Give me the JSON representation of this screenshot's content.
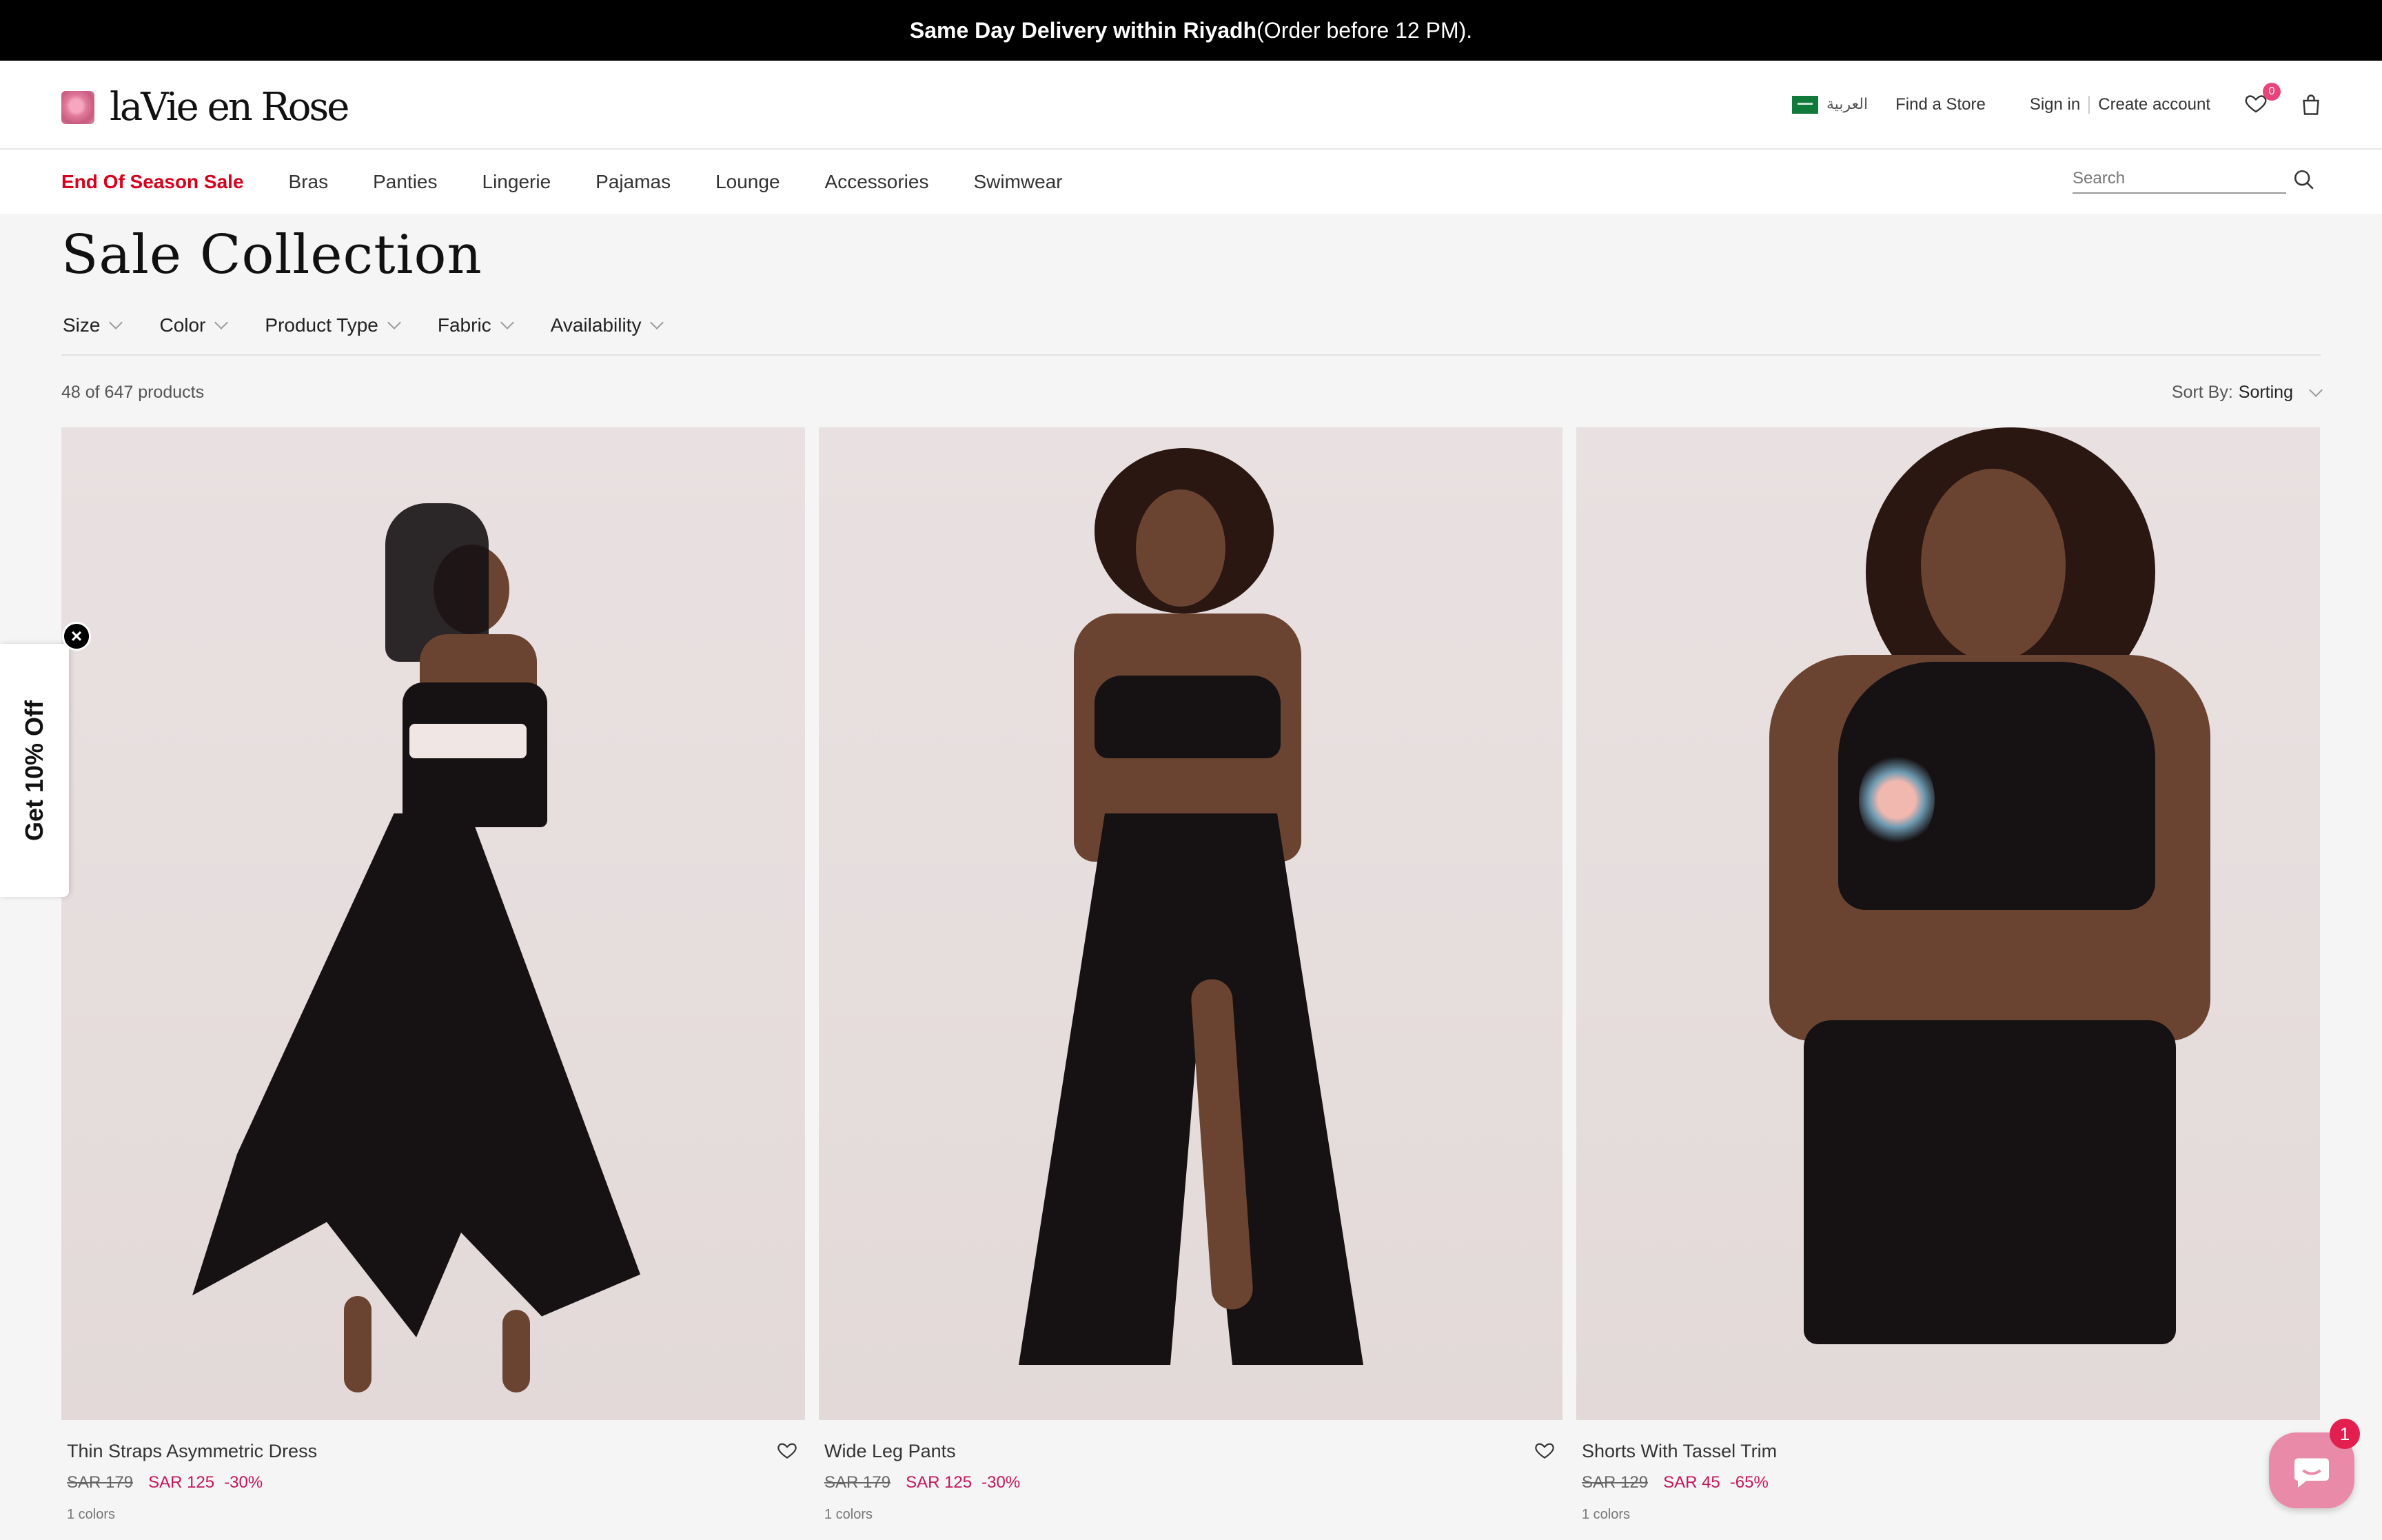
{
  "announcement": {
    "bold": "Same Day Delivery within Riyadh",
    "rest": " (Order before 12 PM)."
  },
  "header": {
    "logo_text": "laVie en Rose",
    "language": "العربية",
    "find_store": "Find a Store",
    "sign_in": "Sign in",
    "create_account": "Create account",
    "wishlist_count": "0"
  },
  "nav": {
    "items": [
      "End Of Season Sale",
      "Bras",
      "Panties",
      "Lingerie",
      "Pajamas",
      "Lounge",
      "Accessories",
      "Swimwear"
    ],
    "search_placeholder": "Search"
  },
  "page": {
    "title": "Sale Collection",
    "filters": [
      "Size",
      "Color",
      "Product Type",
      "Fabric",
      "Availability"
    ],
    "count": "48 of 647 products",
    "sort_label": "Sort By:",
    "sort_value": "Sorting"
  },
  "products": [
    {
      "name": "Thin Straps Asymmetric Dress",
      "old_price": "SAR 179",
      "new_price": "SAR 125",
      "discount": "-30%",
      "colors": "1 colors"
    },
    {
      "name": "Wide Leg Pants",
      "old_price": "SAR 179",
      "new_price": "SAR 125",
      "discount": "-30%",
      "colors": "1 colors"
    },
    {
      "name": "Shorts With Tassel Trim",
      "old_price": "SAR 129",
      "new_price": "SAR 45",
      "discount": "-65%",
      "colors": "1 colors"
    }
  ],
  "promo": {
    "text": "Get 10% Off",
    "close_glyph": "×"
  },
  "chat": {
    "badge": "1"
  },
  "colors": {
    "sale_red": "#d8001d",
    "price_pink": "#c2185b",
    "chat_pink": "#e98aa8"
  }
}
